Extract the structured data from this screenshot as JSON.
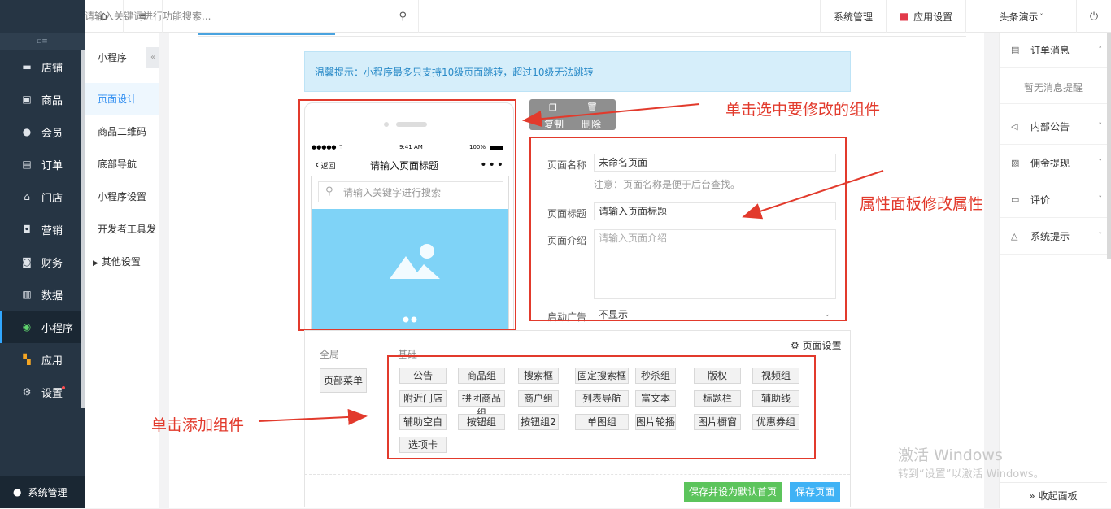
{
  "topbar": {
    "search_placeholder": "请输入关键词进行功能搜索...",
    "system_management": "系统管理",
    "app_settings": "应用设置",
    "shop_name": "头条演示"
  },
  "leftnav": {
    "items": [
      {
        "label": "店铺",
        "icon": "store-icon"
      },
      {
        "label": "商品",
        "icon": "goods-icon"
      },
      {
        "label": "会员",
        "icon": "member-icon"
      },
      {
        "label": "订单",
        "icon": "order-icon"
      },
      {
        "label": "门店",
        "icon": "shop-icon"
      },
      {
        "label": "营销",
        "icon": "gift-icon"
      },
      {
        "label": "财务",
        "icon": "finance-icon"
      },
      {
        "label": "数据",
        "icon": "chart-icon"
      },
      {
        "label": "小程序",
        "icon": "miniapp-icon"
      },
      {
        "label": "应用",
        "icon": "apps-icon"
      },
      {
        "label": "设置",
        "icon": "gear-icon"
      }
    ],
    "footer": "系统管理"
  },
  "subnav": {
    "title": "小程序",
    "items": [
      "页面设计",
      "商品二维码",
      "底部导航",
      "小程序设置",
      "开发者工具发",
      "其他设置"
    ]
  },
  "tip": "温馨提示：小程序最多只支持10级页面跳转，超过10级无法跳转",
  "phone": {
    "time": "9:41 AM",
    "battery": "100%",
    "back": "返回",
    "title": "请输入页面标题",
    "search_placeholder": "请输入关键字进行搜索"
  },
  "toolbar": {
    "copy": "复制",
    "delete": "删除"
  },
  "props": {
    "page_name_label": "页面名称",
    "page_name_value": "未命名页面",
    "page_name_note": "注意：页面名称是便于后台查找。",
    "page_title_label": "页面标题",
    "page_title_value": "请输入页面标题",
    "page_intro_label": "页面介绍",
    "page_intro_placeholder": "请输入页面介绍",
    "ad_label": "启动广告",
    "ad_value": "不显示"
  },
  "components": {
    "global_label": "全局",
    "basic_label": "基础",
    "page_settings": "页面设置",
    "global_buttons": [
      "页部菜单"
    ],
    "basic_buttons": [
      "公告",
      "商品组",
      "搜索框",
      "固定搜索框",
      "秒杀组",
      "版权",
      "视频组",
      "附近门店",
      "拼团商品组",
      "商户组",
      "列表导航",
      "富文本",
      "标题栏",
      "辅助线",
      "辅助空白",
      "按钮组",
      "按钮组2",
      "单图组",
      "图片轮播",
      "图片橱窗",
      "优惠券组",
      "选项卡"
    ],
    "save_default": "保存并设为默认首页",
    "save": "保存页面"
  },
  "rightpanel": {
    "items": [
      {
        "label": "订单消息",
        "icon": "doc-icon"
      },
      {
        "label": "内部公告",
        "icon": "speaker-icon"
      },
      {
        "label": "佣金提现",
        "icon": "wallet-icon"
      },
      {
        "label": "评价",
        "icon": "comment-icon"
      },
      {
        "label": "系统提示",
        "icon": "bell-icon"
      }
    ],
    "empty": "暂无消息提醒",
    "collapse": "» 收起面板"
  },
  "annotations": {
    "select": "单击选中要修改的组件",
    "props": "属性面板修改属性",
    "add": "单击添加组件"
  },
  "watermark": {
    "line1": "激活 Windows",
    "line2": "转到“设置”以激活 Windows。"
  }
}
